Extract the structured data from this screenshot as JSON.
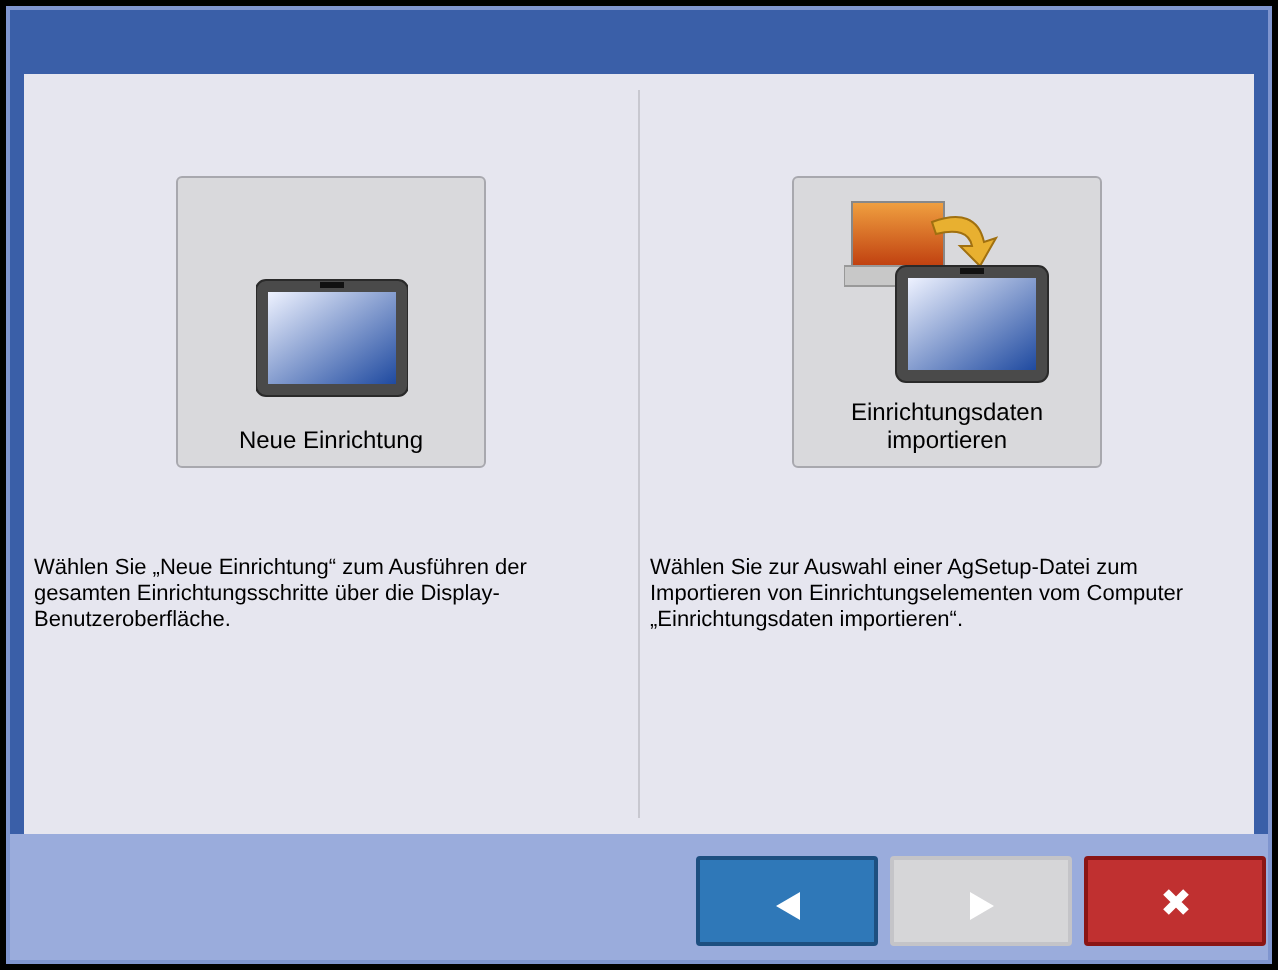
{
  "options": [
    {
      "kind": "new",
      "label": "Neue Einrichtung",
      "description": "Wählen Sie „Neue Einrichtung“ zum Ausführen der gesamten Einrichtungsschritte über die Display-Benutzeroberfläche."
    },
    {
      "kind": "import",
      "label": "Einrichtungsdaten importieren",
      "description": "Wählen Sie zur Auswahl einer AgSetup-Datei zum Importieren von Einrichtungselementen vom Computer „Einrichtungsdaten importieren“."
    }
  ],
  "nav_buttons": [
    {
      "kind": "back",
      "disabled": false
    },
    {
      "kind": "next",
      "disabled": true
    },
    {
      "kind": "cancel",
      "disabled": false
    }
  ]
}
